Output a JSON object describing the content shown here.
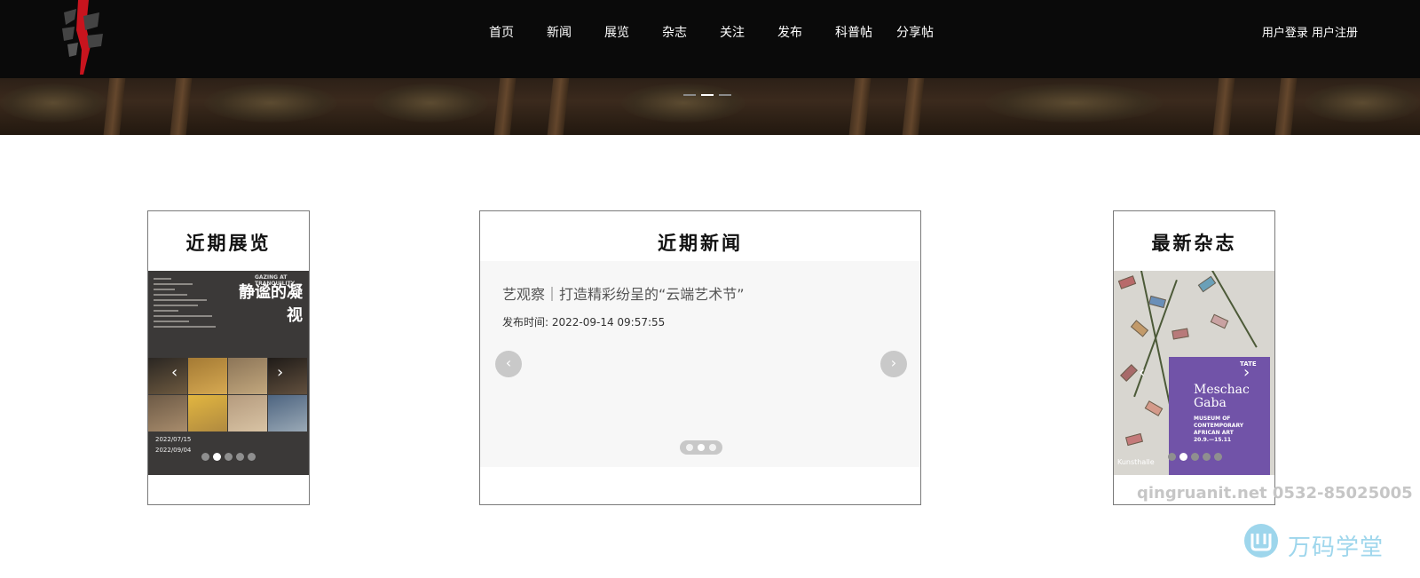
{
  "nav": {
    "items": [
      "首页",
      "新闻",
      "展览",
      "杂志",
      "关注",
      "发布",
      "科普帖",
      "分享帖"
    ]
  },
  "auth": {
    "login": "用户登录",
    "register": "用户注册"
  },
  "cards": {
    "exhibition": {
      "title": "近期展览",
      "poster": {
        "cn_title": "静谧的凝视",
        "en_title": "GAZING AT TRANQUILITY",
        "date_start": "2022/07/15",
        "date_end": "2022/09/04"
      },
      "slide_count": 5,
      "active_slide": 2
    },
    "news": {
      "title": "近期新闻",
      "headline": "艺观察｜打造精彩纷呈的“云端艺术节”",
      "published": "发布时间: 2022-09-14 09:57:55",
      "slide_count": 3,
      "active_slide": 2
    },
    "magazine": {
      "title": "最新杂志",
      "poster": {
        "title_line1": "Meschac",
        "title_line2": "Gaba",
        "subtitle": "MUSEUM OF CONTEMPORARY AFRICAN ART",
        "dates": "20.9.—15.11",
        "brand": "TATE",
        "venue": "Kunsthalle"
      },
      "slide_count": 5,
      "active_slide": 2
    }
  },
  "watermark": {
    "contact": "qingruanit.net 0532-85025005",
    "brand": "万码学堂"
  },
  "colors": {
    "header_bg": "#0a0a0a",
    "magazine_panel": "#7153a8",
    "watermark_brand": "#9ed6ec"
  }
}
